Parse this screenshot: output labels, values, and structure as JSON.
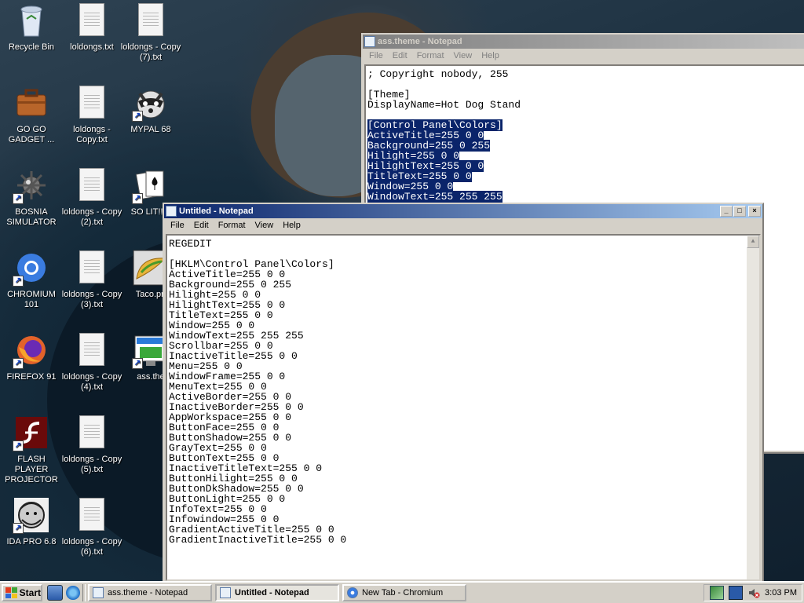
{
  "desktop": {
    "icons": [
      {
        "label": "Recycle Bin",
        "type": "recycle",
        "col": 0,
        "row": 0
      },
      {
        "label": "loldongs.txt",
        "type": "doc",
        "col": 1,
        "row": 0
      },
      {
        "label": "loldongs - Copy (7).txt",
        "type": "doc",
        "col": 2,
        "row": 0
      },
      {
        "label": "GO GO GADGET ...",
        "type": "briefcase",
        "col": 0,
        "row": 1
      },
      {
        "label": "loldongs - Copy.txt",
        "type": "doc",
        "col": 1,
        "row": 1
      },
      {
        "label": "MYPAL 68",
        "type": "raccoon",
        "col": 2,
        "row": 1
      },
      {
        "label": "BOSNIA SIMULATOR",
        "type": "mine",
        "col": 0,
        "row": 2
      },
      {
        "label": "loldongs - Copy (2).txt",
        "type": "doc",
        "col": 1,
        "row": 2
      },
      {
        "label": "SO LIT!! A",
        "type": "cards",
        "col": 2,
        "row": 2
      },
      {
        "label": "CHROMIUM 101",
        "type": "chromium",
        "col": 0,
        "row": 3
      },
      {
        "label": "loldongs - Copy (3).txt",
        "type": "doc",
        "col": 1,
        "row": 3
      },
      {
        "label": "Taco.pn",
        "type": "taco",
        "col": 2,
        "row": 3
      },
      {
        "label": "FIREFOX 91",
        "type": "firefox",
        "col": 0,
        "row": 4
      },
      {
        "label": "loldongs - Copy (4).txt",
        "type": "doc",
        "col": 1,
        "row": 4
      },
      {
        "label": "ass.the",
        "type": "theme",
        "col": 2,
        "row": 4
      },
      {
        "label": "FLASH PLAYER PROJECTOR",
        "type": "flash",
        "col": 0,
        "row": 5
      },
      {
        "label": "loldongs - Copy (5).txt",
        "type": "doc",
        "col": 1,
        "row": 5
      },
      {
        "label": "IDA PRO 6.8",
        "type": "ida",
        "col": 0,
        "row": 6
      },
      {
        "label": "loldongs - Copy (6).txt",
        "type": "doc",
        "col": 1,
        "row": 6
      }
    ]
  },
  "bg_window": {
    "title": "ass.theme - Notepad",
    "menu": [
      "File",
      "Edit",
      "Format",
      "View",
      "Help"
    ],
    "lines": [
      {
        "text": "; Copyright nobody, 255",
        "selected": false
      },
      {
        "text": "",
        "selected": false
      },
      {
        "text": "[Theme]",
        "selected": false
      },
      {
        "text": "DisplayName=Hot Dog Stand",
        "selected": false
      },
      {
        "text": "",
        "selected": false
      },
      {
        "text": "[Control Panel\\Colors]",
        "selected": true
      },
      {
        "text": "ActiveTitle=255 0 0",
        "selected": true
      },
      {
        "text": "Background=255 0 255",
        "selected": true
      },
      {
        "text": "Hilight=255 0 0",
        "selected": true
      },
      {
        "text": "HilightText=255 0 0",
        "selected": true
      },
      {
        "text": "TitleText=255 0 0",
        "selected": true
      },
      {
        "text": "Window=255 0 0",
        "selected": true
      },
      {
        "text": "WindowText=255 255 255",
        "selected": true
      }
    ]
  },
  "fg_window": {
    "title": "Untitled - Notepad",
    "menu": [
      "File",
      "Edit",
      "Format",
      "View",
      "Help"
    ],
    "buttons": {
      "minimize": "_",
      "maximize": "□",
      "close": "×"
    },
    "lines": [
      "REGEDIT",
      "",
      "[HKLM\\Control Panel\\Colors]",
      "ActiveTitle=255 0 0",
      "Background=255 0 255",
      "Hilight=255 0 0",
      "HilightText=255 0 0",
      "TitleText=255 0 0",
      "Window=255 0 0",
      "WindowText=255 255 255",
      "Scrollbar=255 0 0",
      "InactiveTitle=255 0 0",
      "Menu=255 0 0",
      "WindowFrame=255 0 0",
      "MenuText=255 0 0",
      "ActiveBorder=255 0 0",
      "InactiveBorder=255 0 0",
      "AppWorkspace=255 0 0",
      "ButtonFace=255 0 0",
      "ButtonShadow=255 0 0",
      "GrayText=255 0 0",
      "ButtonText=255 0 0",
      "InactiveTitleText=255 0 0",
      "ButtonHilight=255 0 0",
      "ButtonDkShadow=255 0 0",
      "ButtonLight=255 0 0",
      "InfoText=255 0 0",
      "Infowindow=255 0 0",
      "GradientActiveTitle=255 0 0",
      "GradientInactiveTitle=255 0 0"
    ]
  },
  "taskbar": {
    "start_label": "Start",
    "tasks": [
      {
        "label": "ass.theme - Notepad",
        "active": false,
        "icon": "notepad-icon"
      },
      {
        "label": "Untitled - Notepad",
        "active": true,
        "icon": "notepad-icon"
      },
      {
        "label": "New Tab - Chromium",
        "active": false,
        "icon": "chromium-icon"
      }
    ],
    "clock": "3:03 PM"
  },
  "colors": {
    "title_active_start": "#0a246a",
    "title_active_end": "#a6caf0",
    "selection": "#0a246a",
    "face": "#d4d0c8"
  }
}
